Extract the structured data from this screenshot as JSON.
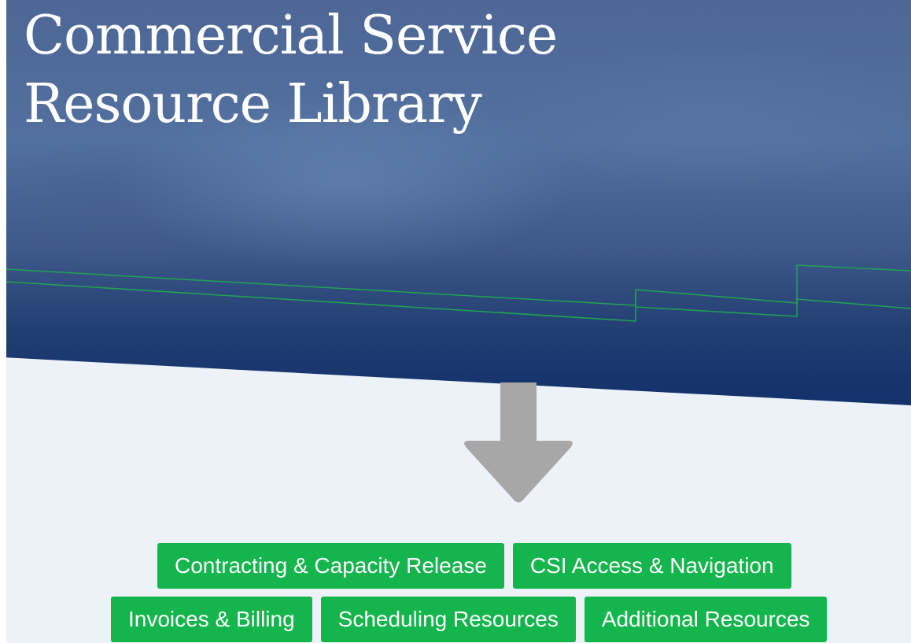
{
  "hero": {
    "title_line1": "Commercial Service",
    "title_line2": "Resource Library"
  },
  "colors": {
    "hero_blue": "#12316a",
    "accent_green": "#13b54c",
    "arrow_gray": "#a7a7a7",
    "page_bg": "#edf2f8"
  },
  "icons": {
    "down_arrow": "down-arrow-icon"
  },
  "buttons": {
    "row1": [
      {
        "label": "Contracting & Capacity Release"
      },
      {
        "label": "CSI Access & Navigation"
      }
    ],
    "row2": [
      {
        "label": "Invoices & Billing"
      },
      {
        "label": "Scheduling Resources"
      },
      {
        "label": "Additional Resources"
      }
    ]
  }
}
